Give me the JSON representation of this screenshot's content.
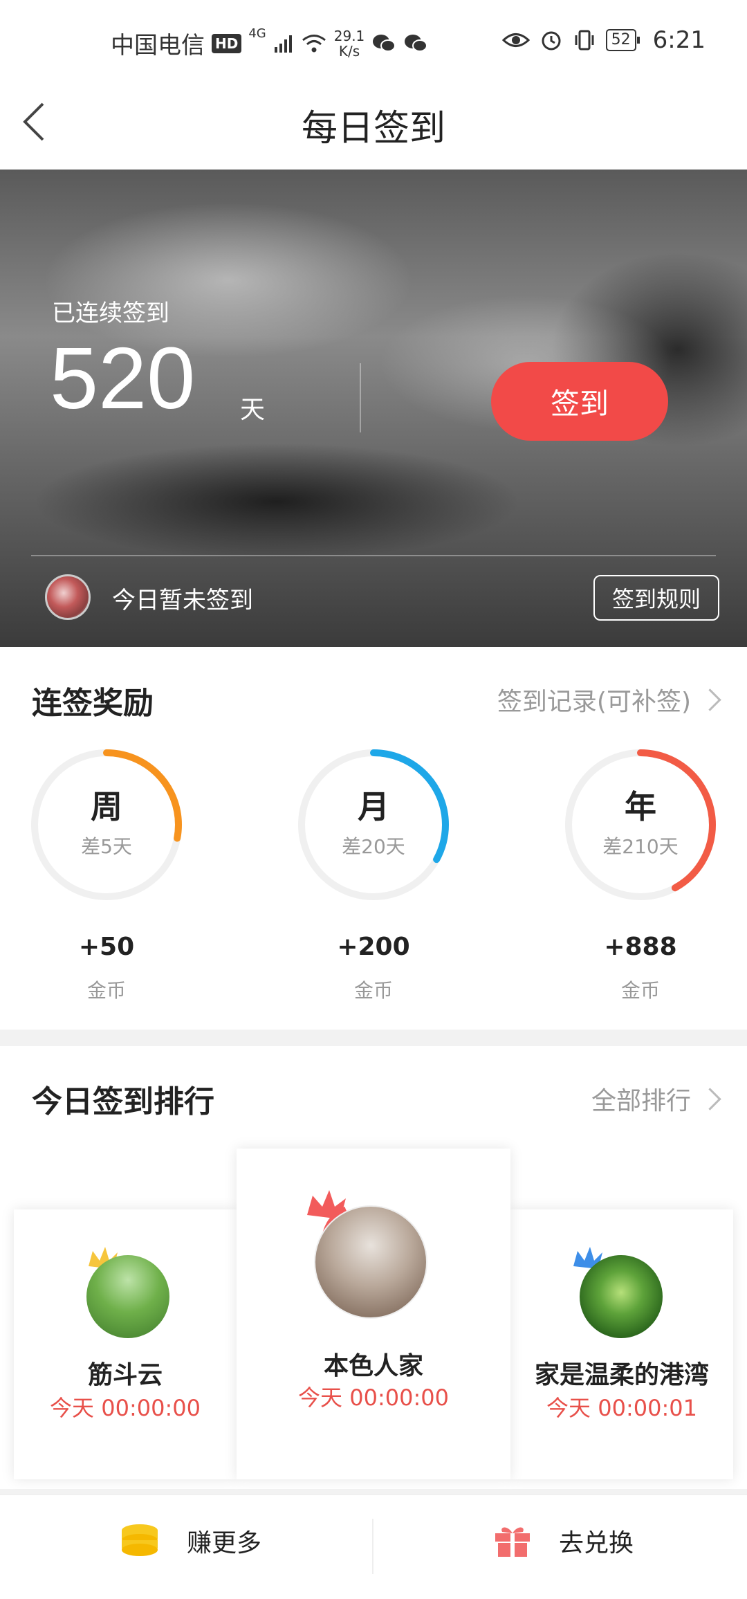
{
  "status_bar": {
    "carrier": "中国电信",
    "hd": "HD",
    "network": "4G",
    "speed_value": "29.1",
    "speed_unit": "K/s",
    "battery": "52",
    "time": "6:21"
  },
  "nav": {
    "title": "每日签到"
  },
  "hero": {
    "streak_label": "已连续签到",
    "streak_count": "520",
    "streak_unit": "天",
    "checkin_button": "签到",
    "status_text": "今日暂未签到",
    "rules_button": "签到规则"
  },
  "rewards": {
    "title": "连签奖励",
    "record_link": "签到记录(可补签)",
    "items": [
      {
        "label": "周",
        "remaining": "差5天",
        "amount": "+50",
        "unit": "金币",
        "progress": 0.28,
        "color": "#f7931e"
      },
      {
        "label": "月",
        "remaining": "差20天",
        "amount": "+200",
        "unit": "金币",
        "progress": 0.33,
        "color": "#1ea7e8"
      },
      {
        "label": "年",
        "remaining": "差210天",
        "amount": "+888",
        "unit": "金币",
        "progress": 0.42,
        "color": "#f25b45"
      }
    ]
  },
  "ranking": {
    "title": "今日签到排行",
    "all_link": "全部排行",
    "entries": [
      {
        "rank": 2,
        "name": "筋斗云",
        "time": "今天 00:00:00",
        "crown_color": "#f6c53d"
      },
      {
        "rank": 1,
        "name": "本色人家",
        "time": "今天 00:00:00",
        "crown_color": "#f25b5b"
      },
      {
        "rank": 3,
        "name": "家是温柔的港湾",
        "time": "今天 00:00:01",
        "crown_color": "#3d8ee8"
      }
    ]
  },
  "bottom": {
    "earn_label": "赚更多",
    "exchange_label": "去兑换"
  }
}
